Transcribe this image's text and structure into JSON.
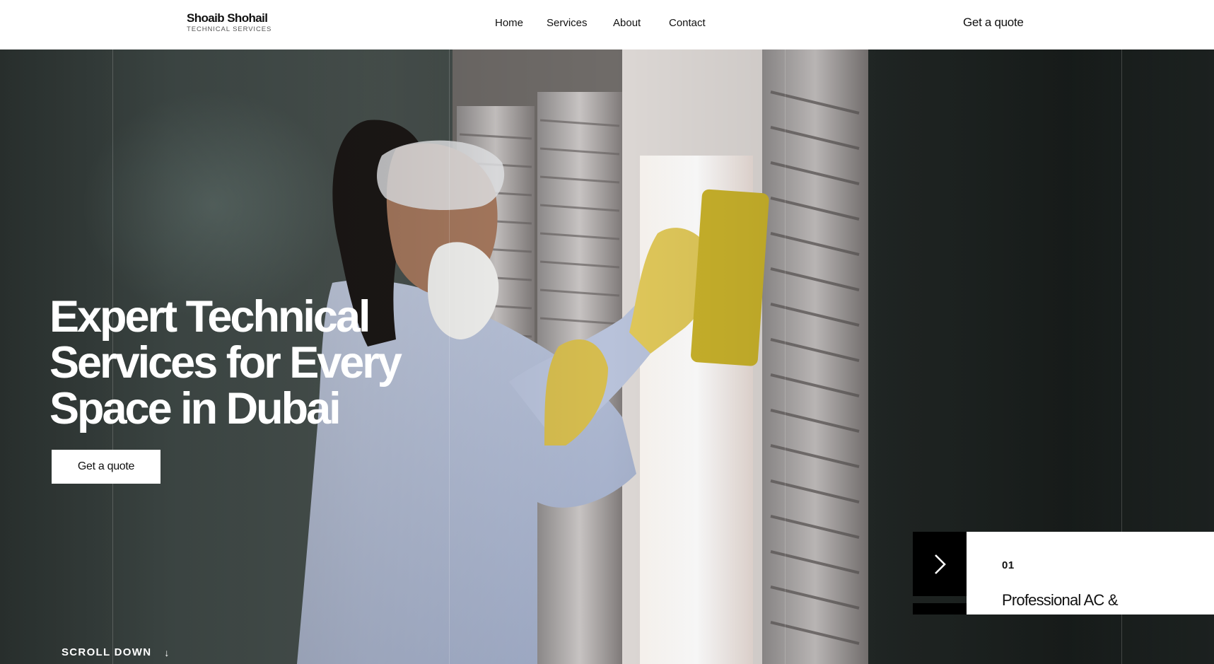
{
  "brand": {
    "name": "Shoaib Shohail",
    "tagline": "TECHNICAL SERVICES"
  },
  "nav": {
    "items": [
      {
        "label": "Home"
      },
      {
        "label": "Services"
      },
      {
        "label": "About"
      },
      {
        "label": "Contact"
      }
    ],
    "cta_label": "Get a quote"
  },
  "hero": {
    "title_lines": [
      "Expert Technical",
      "Services for Every",
      "Space in Dubai"
    ],
    "cta_label": "Get a quote",
    "scroll_label": "SCROLL DOWN",
    "scroll_icon": "arrow-down-icon",
    "background_image": "photo of worker in mask, goggles and yellow gloves cleaning a window"
  },
  "slider": {
    "next_icon": "chevron-right-icon",
    "current_number": "01",
    "current_title": "Professional AC &"
  },
  "colors": {
    "header_bg": "#ffffff",
    "text_dark": "#111111",
    "hero_text": "#ffffff",
    "slider_button_bg": "#000000"
  }
}
